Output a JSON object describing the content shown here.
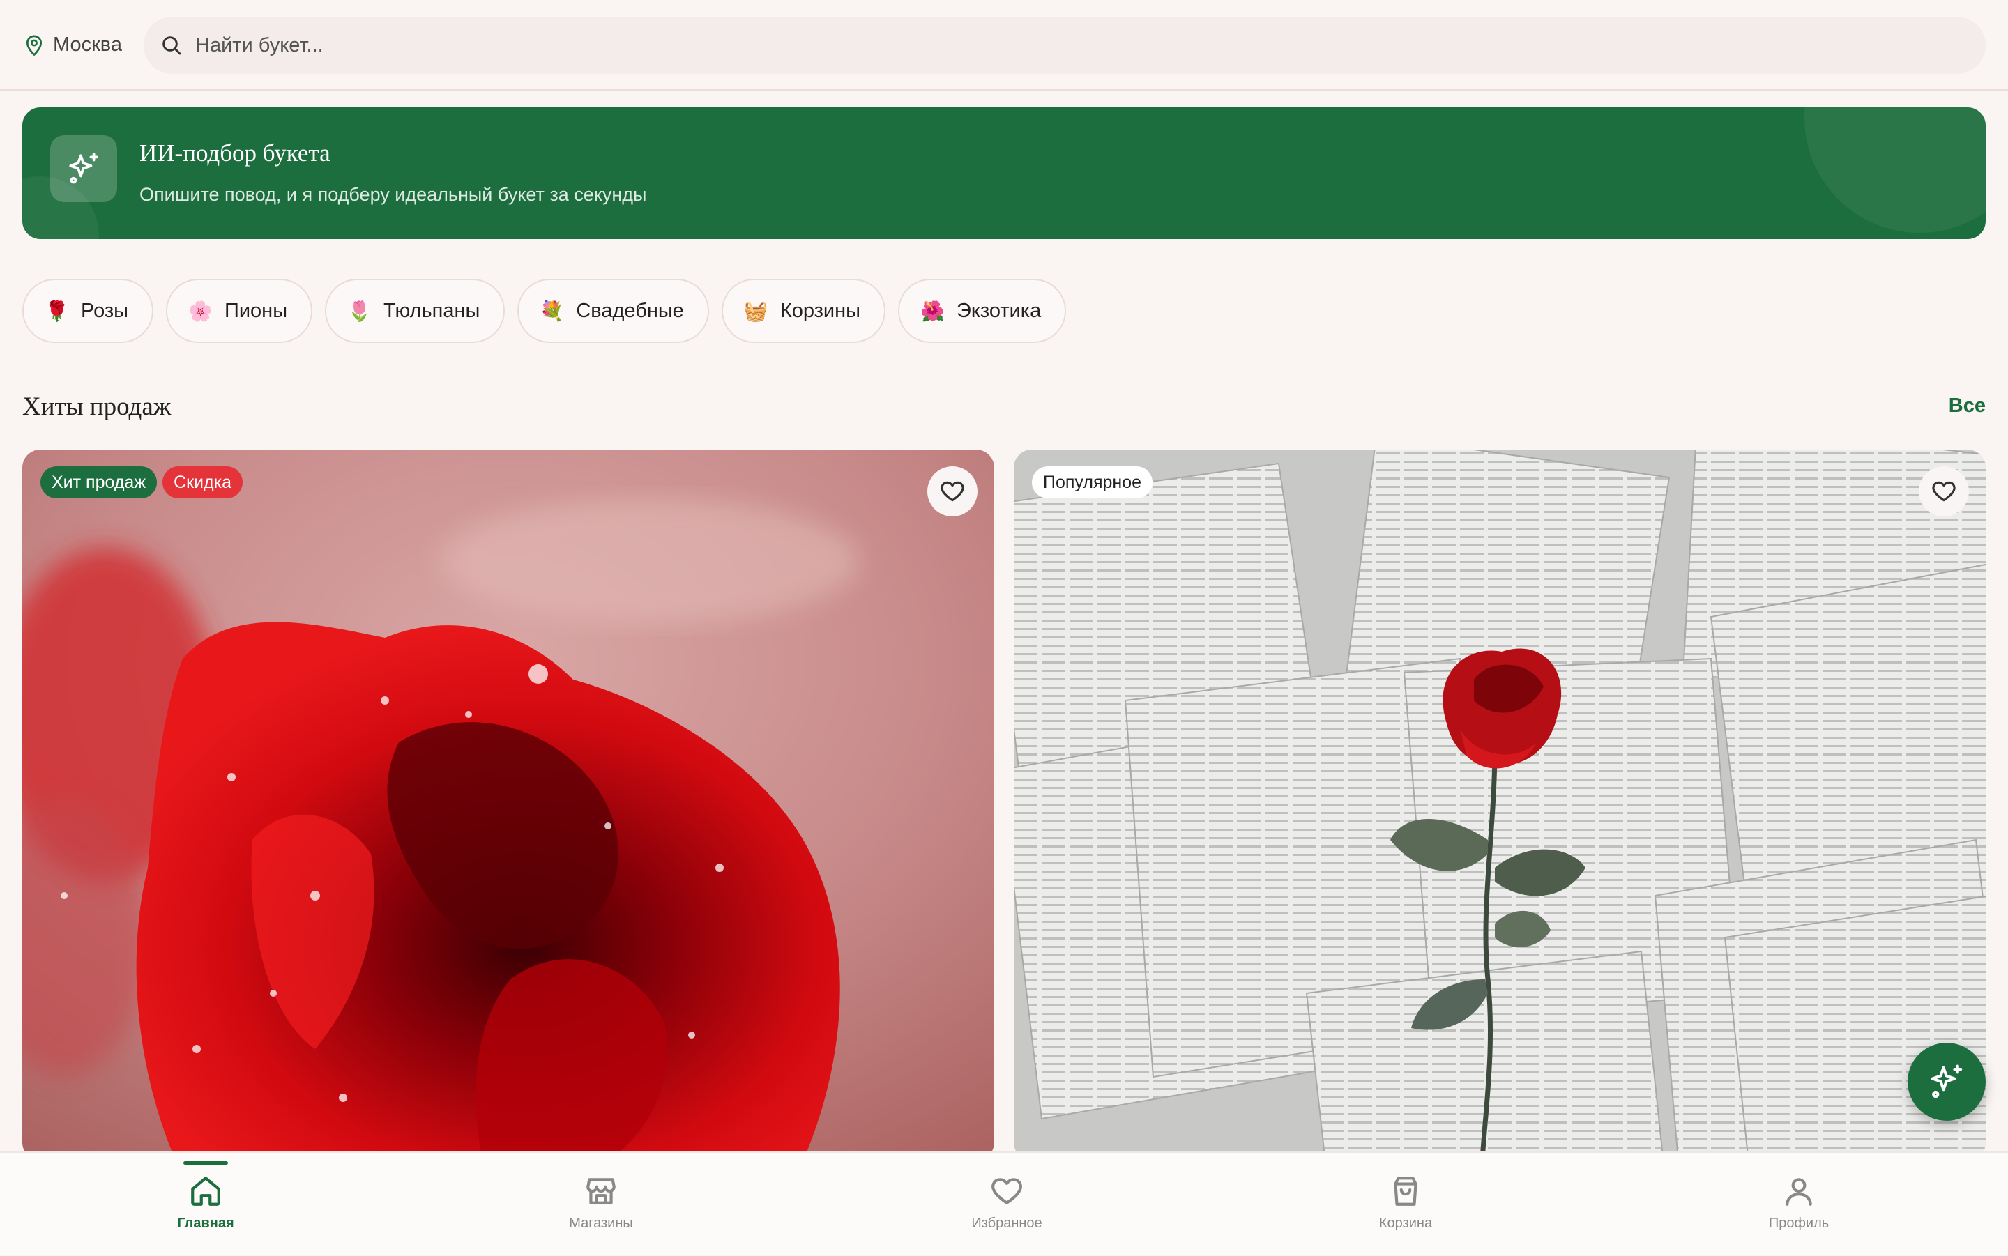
{
  "header": {
    "city": "Москва",
    "search_placeholder": "Найти букет..."
  },
  "ai_banner": {
    "title": "ИИ-подбор букета",
    "subtitle": "Опишите повод, и я подберу идеальный букет за секунды"
  },
  "categories": [
    {
      "emoji": "🌹",
      "label": "Розы"
    },
    {
      "emoji": "🌸",
      "label": "Пионы"
    },
    {
      "emoji": "🌷",
      "label": "Тюльпаны"
    },
    {
      "emoji": "💐",
      "label": "Свадебные"
    },
    {
      "emoji": "🧺",
      "label": "Корзины"
    },
    {
      "emoji": "🌺",
      "label": "Экзотика"
    }
  ],
  "section": {
    "title": "Хиты продаж",
    "see_all": "Все"
  },
  "products": [
    {
      "badges": [
        "Хит продаж",
        "Скидка"
      ],
      "image": "red-rose-closeup-photo"
    },
    {
      "badges": [
        "Популярное"
      ],
      "image": "rose-on-book-pages-photo"
    }
  ],
  "bottom_nav": [
    {
      "label": "Главная",
      "icon": "home-icon",
      "active": true
    },
    {
      "label": "Магазины",
      "icon": "store-icon",
      "active": false
    },
    {
      "label": "Избранное",
      "icon": "heart-icon",
      "active": false
    },
    {
      "label": "Корзина",
      "icon": "bag-icon",
      "active": false
    },
    {
      "label": "Профиль",
      "icon": "user-icon",
      "active": false
    }
  ],
  "colors": {
    "accent": "#1d6e3e",
    "sale": "#e5333a",
    "background": "#faf5f3"
  }
}
